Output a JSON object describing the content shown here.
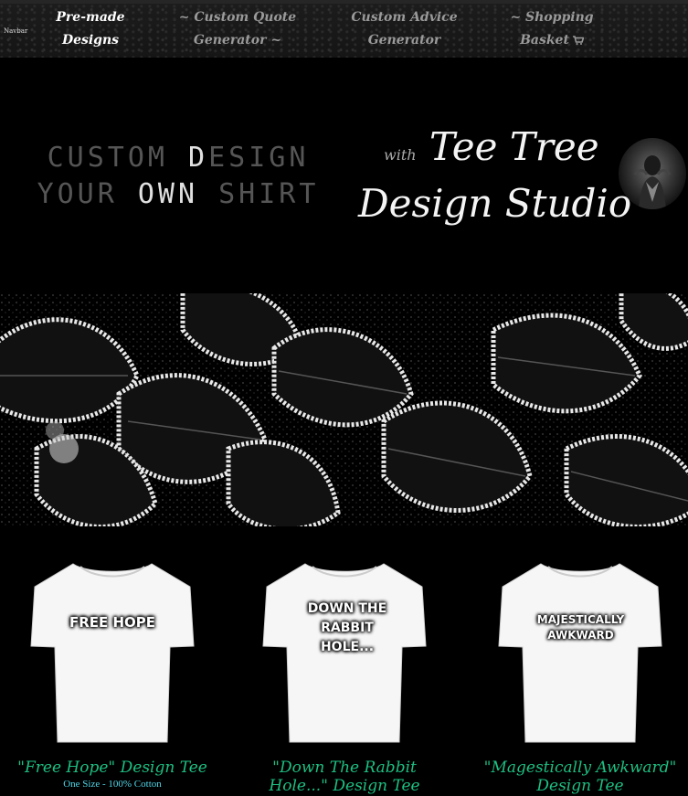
{
  "navbar": {
    "brand": "Navbar",
    "items": [
      {
        "line1": "Pre-made",
        "line2": "Designs"
      },
      {
        "line1": "~ Custom Quote",
        "line2": "Generator ~"
      },
      {
        "line1": "Custom Advice",
        "line2": "Generator"
      },
      {
        "line1": "~ Shopping",
        "line2": "Basket"
      }
    ]
  },
  "hero": {
    "line1_prefix": "CUSTOM ",
    "line1_hl": "D",
    "line1_suffix": "ESIGN",
    "line2_a": "YOUR ",
    "line2_hl": "OWN",
    "line2_b": " SHIRT"
  },
  "brand": {
    "with": "with",
    "line1": "Tee Tree",
    "line2": "Design Studio"
  },
  "products": [
    {
      "shirt_text": "FREE HOPE",
      "title_line1": "\"Free Hope\" Design Tee",
      "title_line2": "",
      "subtitle": "One Size - 100% Cotton"
    },
    {
      "shirt_text": "DOWN THE RABBIT HOLE...",
      "title_line1": "\"Down The Rabbit",
      "title_line2": "Hole...\" Design Tee",
      "subtitle": ""
    },
    {
      "shirt_text": "MAJESTICALLY AWKWARD",
      "title_line1": "\"Magestically Awkward\"",
      "title_line2": "Design Tee",
      "subtitle": ""
    }
  ],
  "colors": {
    "title_green": "#1dbf82",
    "subtitle_cyan": "#4fd6e8"
  }
}
